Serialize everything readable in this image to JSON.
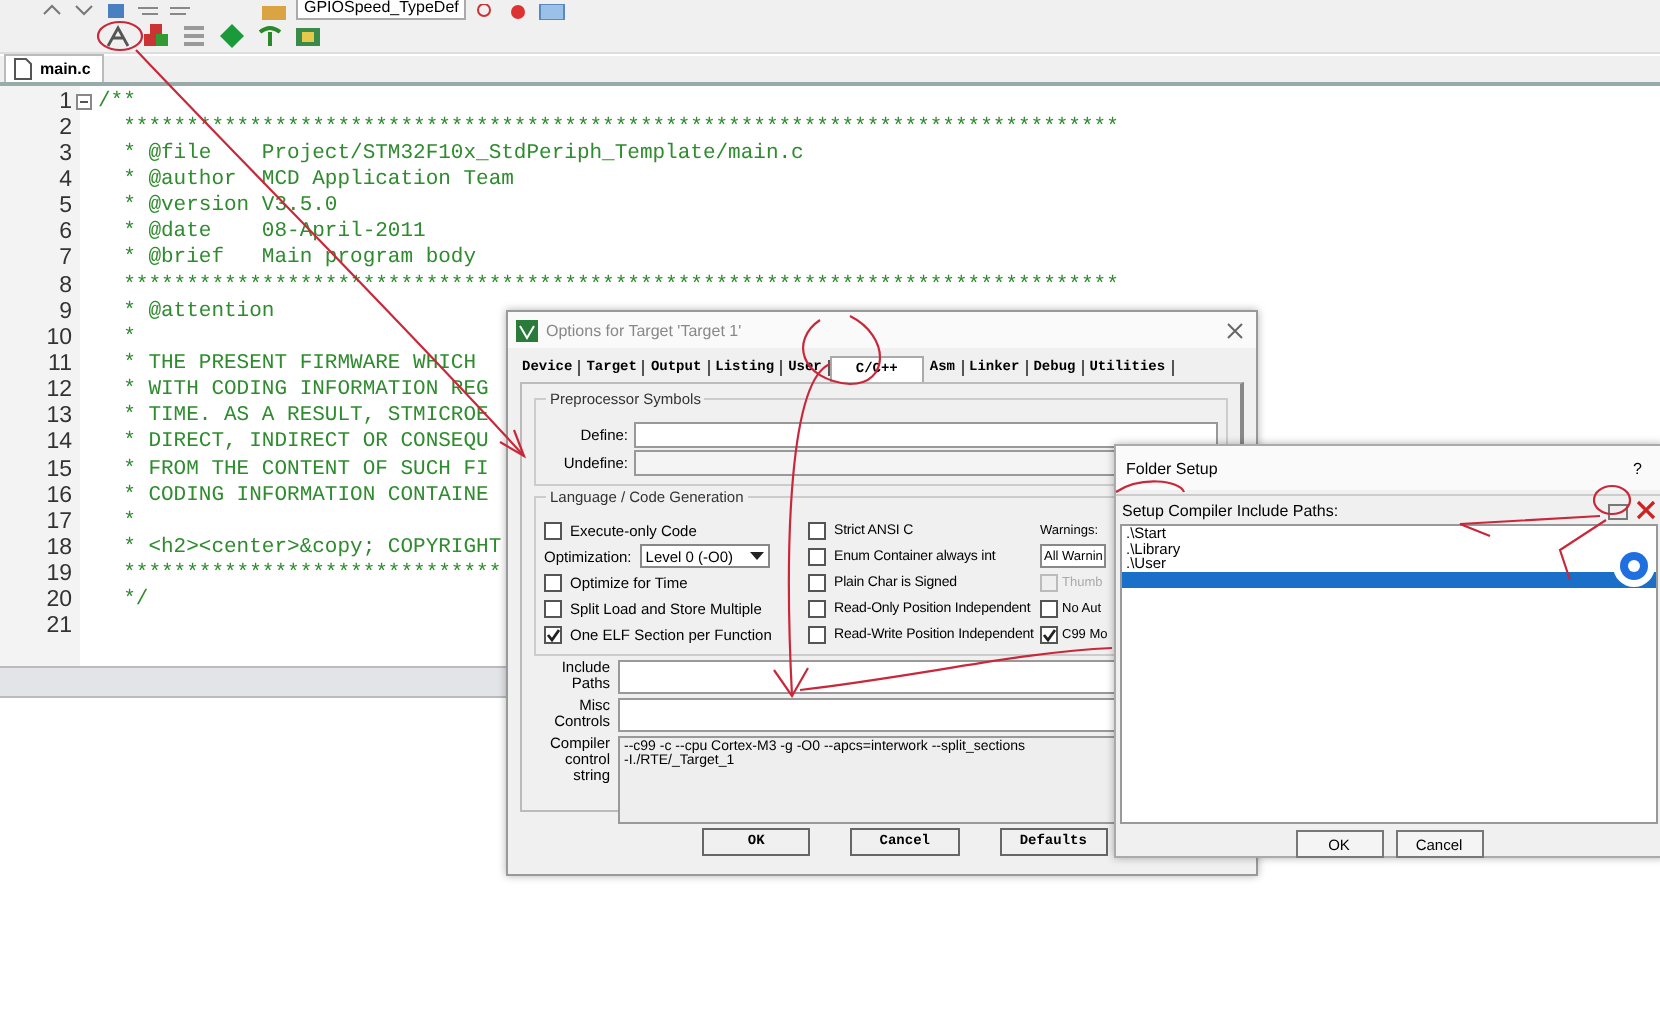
{
  "toolbar": {
    "symbol_combo": "GPIOSpeed_TypeDef"
  },
  "editor_tabs": [
    {
      "label": "main.c",
      "selected": true
    }
  ],
  "code_lines": [
    {
      "number": "1",
      "text": "/**",
      "fold": true
    },
    {
      "number": "2",
      "text": "  *******************************************************************************"
    },
    {
      "number": "3",
      "text": "  * @file    Project/STM32F10x_StdPeriph_Template/main.c"
    },
    {
      "number": "4",
      "text": "  * @author  MCD Application Team"
    },
    {
      "number": "5",
      "text": "  * @version V3.5.0"
    },
    {
      "number": "6",
      "text": "  * @date    08-April-2011"
    },
    {
      "number": "7",
      "text": "  * @brief   Main program body"
    },
    {
      "number": "8",
      "text": "  *******************************************************************************"
    },
    {
      "number": "9",
      "text": "  * @attention"
    },
    {
      "number": "10",
      "text": "  *"
    },
    {
      "number": "11",
      "text": "  * THE PRESENT FIRMWARE WHICH"
    },
    {
      "number": "12",
      "text": "  * WITH CODING INFORMATION REG"
    },
    {
      "number": "13",
      "text": "  * TIME. AS A RESULT, STMICROE"
    },
    {
      "number": "14",
      "text": "  * DIRECT, INDIRECT OR CONSEQU"
    },
    {
      "number": "15",
      "text": "  * FROM THE CONTENT OF SUCH FI"
    },
    {
      "number": "16",
      "text": "  * CODING INFORMATION CONTAINE"
    },
    {
      "number": "17",
      "text": "  *"
    },
    {
      "number": "18",
      "text": "  * <h2><center>&copy; COPYRIGHT"
    },
    {
      "number": "19",
      "text": "  ******************************"
    },
    {
      "number": "20",
      "text": "  */"
    },
    {
      "number": "21"
    }
  ],
  "options_dialog": {
    "title": "Options for Target 'Target 1'",
    "tabs": [
      {
        "label": "Device",
        "selected": false
      },
      {
        "label": "Target",
        "selected": false
      },
      {
        "label": "Output",
        "selected": false
      },
      {
        "label": "Listing",
        "selected": false
      },
      {
        "label": "User",
        "selected": false
      },
      {
        "label": "C/C++",
        "selected": true
      },
      {
        "label": "Asm",
        "selected": false
      },
      {
        "label": "Linker",
        "selected": false
      },
      {
        "label": "Debug",
        "selected": false
      },
      {
        "label": "Utilities",
        "selected": false
      }
    ],
    "preprocessor": {
      "legend": "Preprocessor Symbols",
      "define_label": "Define:",
      "undefine_label": "Undefine:"
    },
    "language": {
      "legend": "Language / Code Generation",
      "column_1": [
        {
          "kind": "checkbox",
          "label": "Execute-only Code",
          "checked": false
        },
        {
          "kind": "select",
          "label": "Optimization:",
          "value": "Level 0 (-O0)"
        },
        {
          "kind": "checkbox",
          "label": "Optimize for Time",
          "checked": false
        },
        {
          "kind": "checkbox",
          "label": "Split Load and Store Multiple",
          "checked": false
        },
        {
          "kind": "checkbox",
          "label": "One ELF Section per Function",
          "checked": true
        }
      ],
      "column_2": [
        {
          "kind": "checkbox",
          "label": "Strict ANSI C",
          "checked": false
        },
        {
          "kind": "checkbox",
          "label": "Enum Container always int",
          "checked": false
        },
        {
          "kind": "checkbox",
          "label": "Plain Char is Signed",
          "checked": false
        },
        {
          "kind": "checkbox",
          "label": "Read-Only Position Independent",
          "checked": false
        },
        {
          "kind": "checkbox",
          "label": "Read-Write Position Independent",
          "checked": false
        }
      ],
      "column_3": [
        {
          "kind": "label",
          "label": "Warnings:"
        },
        {
          "kind": "select",
          "value": "All Warnin"
        },
        {
          "kind": "checkbox",
          "label": "Thumb",
          "checked": false,
          "disabled": true
        },
        {
          "kind": "checkbox",
          "label": "No Aut",
          "checked": false,
          "disabled": false
        },
        {
          "kind": "checkbox",
          "label": "C99 Mo",
          "checked": true,
          "disabled": false
        }
      ]
    },
    "include_paths_label": "Include Paths",
    "misc_controls_label": "Misc Controls",
    "compiler_string_label": "Compiler control string",
    "compiler_string": [
      "--c99 -c --cpu Cortex-M3 -g -O0 --apcs=interwork --split_sections",
      "-I./RTE/_Target_1"
    ],
    "buttons": [
      "OK",
      "Cancel",
      "Defaults"
    ]
  },
  "folder_dialog": {
    "title": "Folder Setup",
    "help": "?",
    "header": "Setup Compiler Include Paths:",
    "paths": [
      {
        "text": ".\\Start",
        "selected": false
      },
      {
        "text": ".\\Library",
        "selected": false
      },
      {
        "text": ".\\User",
        "selected": false
      },
      {
        "selected": true
      }
    ],
    "buttons": [
      "OK",
      "Cancel"
    ]
  }
}
